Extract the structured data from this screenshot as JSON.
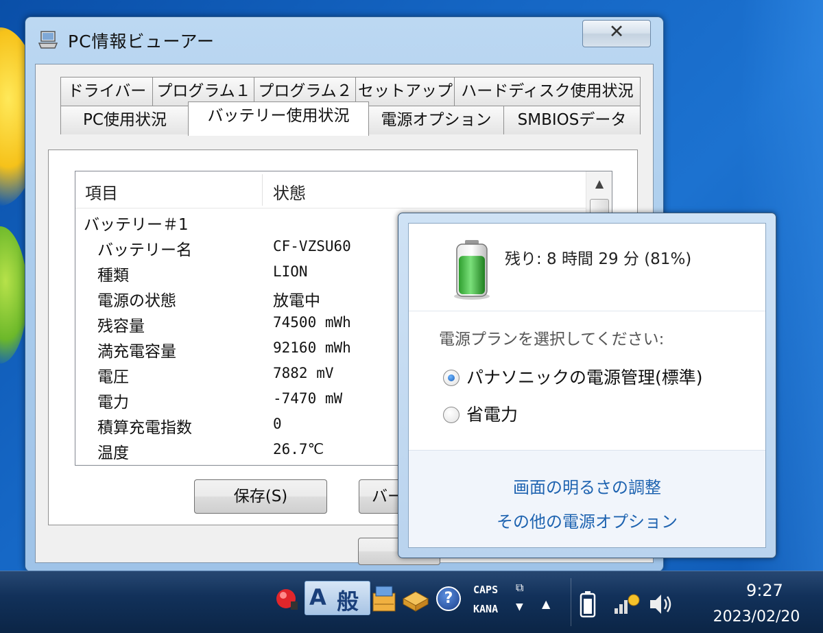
{
  "window": {
    "title": "PC情報ビューアー",
    "close_symbol": "✕"
  },
  "tabs_row1": [
    {
      "label": "ドライバー"
    },
    {
      "label": "プログラム１"
    },
    {
      "label": "プログラム２"
    },
    {
      "label": "セットアップ"
    },
    {
      "label": "ハードディスク使用状況"
    }
  ],
  "tabs_row2": [
    {
      "label": "PC使用状況"
    },
    {
      "label": "バッテリー使用状況",
      "active": true
    },
    {
      "label": "電源オプション"
    },
    {
      "label": "SMBIOSデータ"
    }
  ],
  "list": {
    "headers": [
      "項目",
      "状態"
    ],
    "group": "バッテリー＃1",
    "rows": [
      {
        "name": "バッテリー名",
        "value": "CF-VZSU60"
      },
      {
        "name": "種類",
        "value": "LION"
      },
      {
        "name": "電源の状態",
        "value": "放電中"
      },
      {
        "name": "残容量",
        "value": "74500 mWh"
      },
      {
        "name": "満充電容量",
        "value": "92160 mWh"
      },
      {
        "name": "電圧",
        "value": "7882 mV"
      },
      {
        "name": "電力",
        "value": "-7470 mW"
      },
      {
        "name": "積算充電指数",
        "value": "0"
      },
      {
        "name": "温度",
        "value": "26.7℃"
      }
    ]
  },
  "buttons": {
    "save": "保存(S)",
    "partial": "バー"
  },
  "battery_flyout": {
    "remaining": "残り: 8 時間 29 分 (81%)",
    "charge_fraction": 0.81,
    "plan_prompt": "電源プランを選択してください:",
    "plans": [
      {
        "label": "パナソニックの電源管理(標準)",
        "selected": true
      },
      {
        "label": "省電力",
        "selected": false
      }
    ],
    "links": [
      "画面の明るさの調整",
      "その他の電源オプション"
    ]
  },
  "taskbar": {
    "ime_mode": "A",
    "ime_type": "般",
    "caps": "CAPS",
    "kana": "KANA",
    "help": "?",
    "clock_time": "9:27",
    "clock_date": "2023/02/20"
  },
  "colors": {
    "link": "#1e63b0",
    "battery_green": "#3cc23c",
    "taskbar": "#12315a"
  }
}
